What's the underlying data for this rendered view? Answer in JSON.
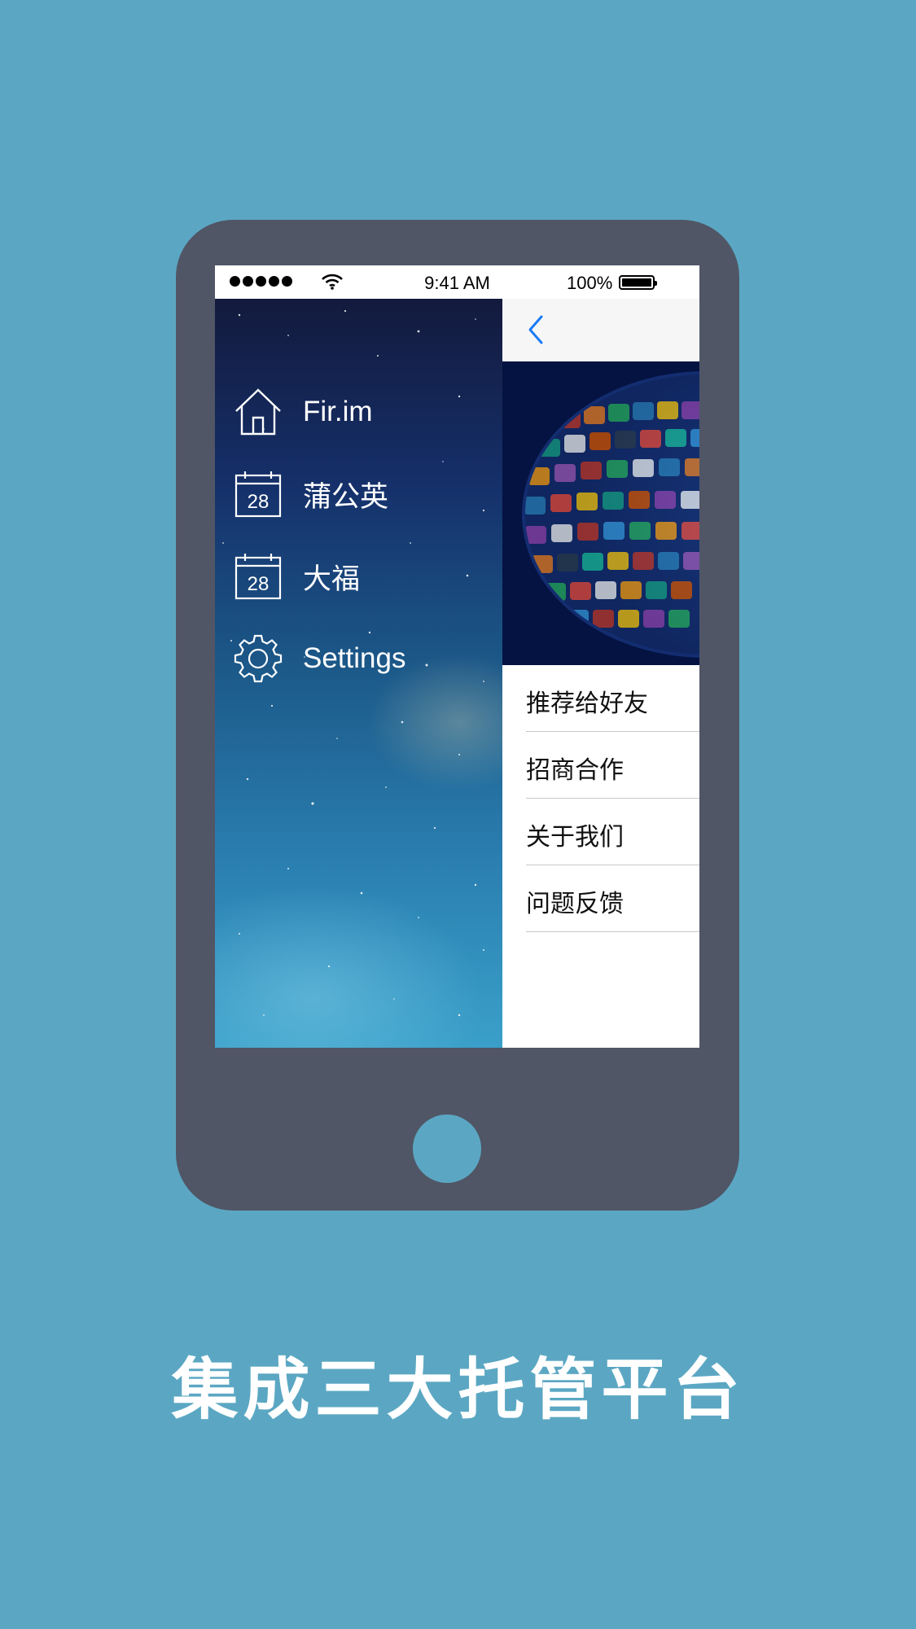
{
  "status_bar": {
    "time": "9:41 AM",
    "battery": "100%"
  },
  "drawer": {
    "items": [
      {
        "label": "Fir.im",
        "icon": "home-icon"
      },
      {
        "label": "蒲公英",
        "icon": "calendar-icon",
        "icon_text": "28"
      },
      {
        "label": "大福",
        "icon": "calendar-icon",
        "icon_text": "28"
      },
      {
        "label": "Settings",
        "icon": "gear-icon"
      }
    ]
  },
  "main": {
    "nav": {
      "back_icon": "chevron-left-icon"
    },
    "list": [
      "推荐给好友",
      "招商合作",
      "关于我们",
      "问题反馈"
    ]
  },
  "caption": "集成三大托管平台",
  "colors": {
    "background": "#5ba7c3",
    "phone": "#505666",
    "accent": "#1a7cf5"
  }
}
